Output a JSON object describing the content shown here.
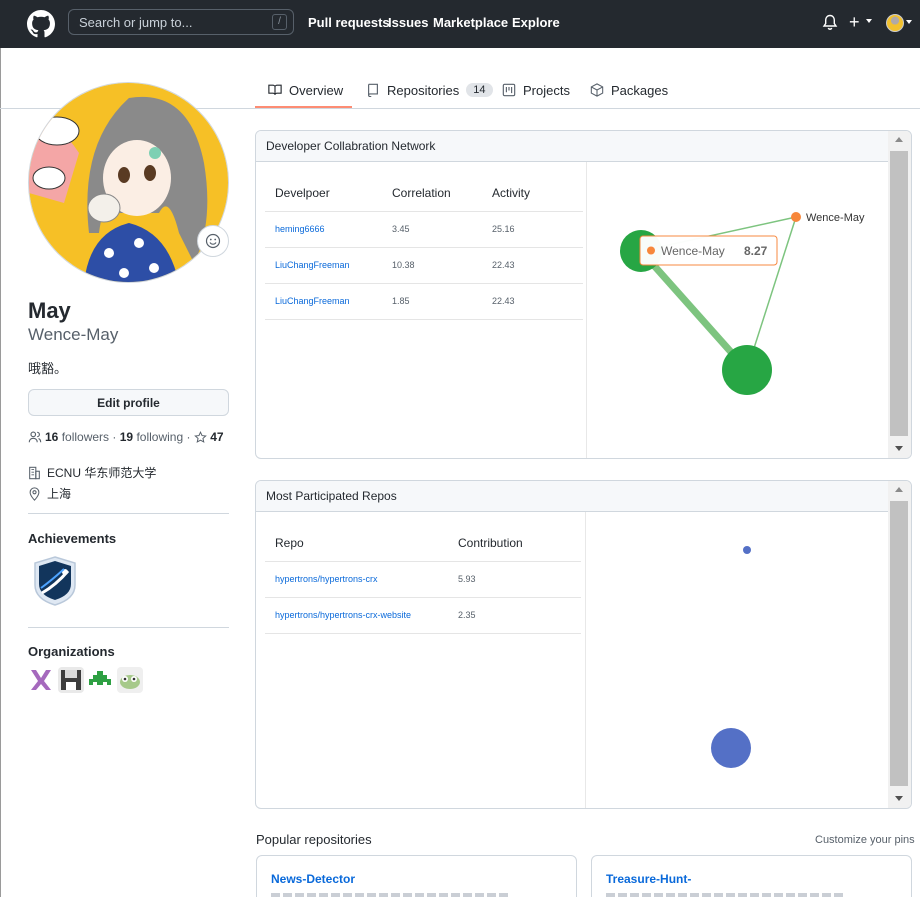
{
  "header": {
    "search_placeholder": "Search or jump to...",
    "slash_hint": "/",
    "nav": [
      "Pull requests",
      "Issues",
      "Marketplace",
      "Explore"
    ],
    "plus_label": "+"
  },
  "tabs": [
    {
      "label": "Overview",
      "active": true
    },
    {
      "label": "Repositories",
      "count": "14"
    },
    {
      "label": "Projects"
    },
    {
      "label": "Packages"
    }
  ],
  "profile": {
    "name": "May",
    "login": "Wence-May",
    "bio": "哦豁。",
    "edit_label": "Edit profile",
    "followers_count": "16",
    "followers_label": "followers",
    "dot": "·",
    "following_count": "19",
    "following_label": "following",
    "stars_count": "47",
    "company": "ECNU 华东师范大学",
    "location": "上海",
    "achievements_title": "Achievements",
    "organizations_title": "Organizations"
  },
  "network_panel": {
    "title": "Developer Collabration Network",
    "columns": [
      "Develpoer",
      "Correlation",
      "Activity"
    ],
    "rows": [
      [
        "heming6666",
        "3.45",
        "25.16"
      ],
      [
        "LiuChangFreeman",
        "10.38",
        "22.43"
      ],
      [
        "LiuChangFreeman",
        "1.85",
        "22.43"
      ]
    ],
    "graph_node_label": "Wence-May",
    "tooltip_name": "Wence-May",
    "tooltip_value": "8.27",
    "colors": {
      "node": "#27a644",
      "edge": "#7dc47f",
      "self": "#f7873b"
    }
  },
  "repos_panel": {
    "title": "Most Participated Repos",
    "columns": [
      "Repo",
      "Contribution"
    ],
    "rows": [
      [
        "hypertrons/hypertrons-crx",
        "5.93"
      ],
      [
        "hypertrons/hypertrons-crx-website",
        "2.35"
      ]
    ],
    "colors": {
      "node": "#5470c6"
    }
  },
  "popular": {
    "title": "Popular repositories",
    "customize": "Customize your pins",
    "repos": [
      "News-Detector",
      "Treasure-Hunt-"
    ]
  }
}
